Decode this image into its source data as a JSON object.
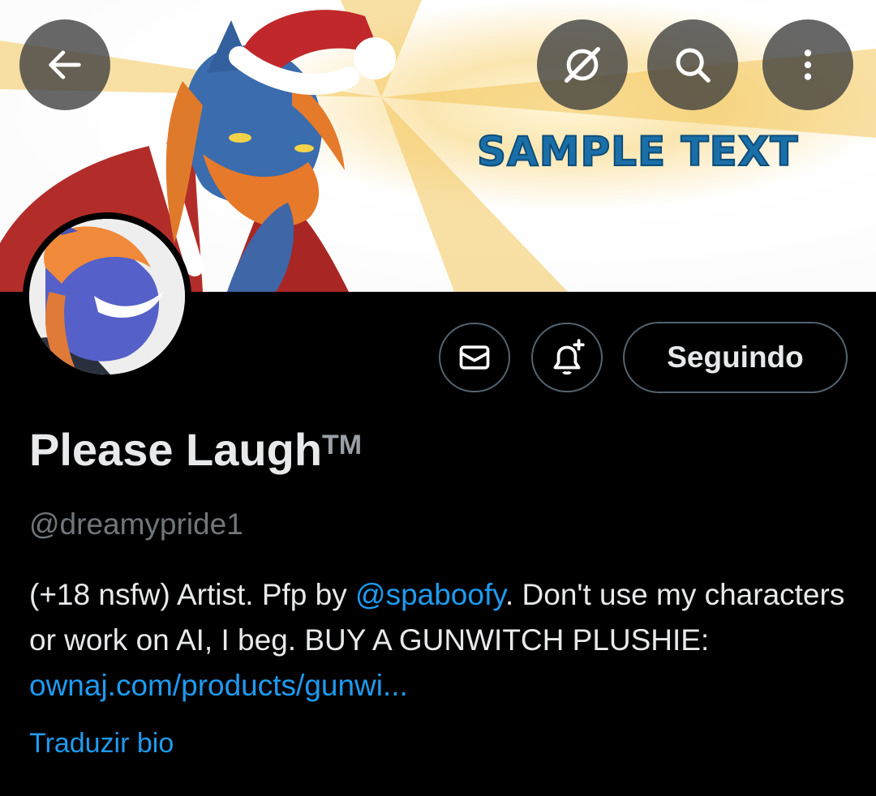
{
  "banner": {
    "text": "SAMPLE TEXT"
  },
  "header": {
    "back_icon": "arrow-left-icon",
    "no_sync_icon": "satellite-off-icon",
    "search_icon": "search-icon",
    "more_icon": "more-vertical-icon"
  },
  "actions": {
    "message_icon": "envelope-icon",
    "notify_icon": "bell-plus-icon",
    "follow_label": "Seguindo"
  },
  "profile": {
    "display_name": "Please Laugh",
    "trademark": "TM",
    "handle": "@dreamypride1",
    "bio": {
      "part1": "(+18 nsfw) Artist. Pfp by ",
      "mention": "@spaboofy",
      "part2": ". Don't use my characters or work on AI, I beg.  BUY A GUNWITCH PLUSHIE: ",
      "link": "ownaj.com/products/gunwi..."
    },
    "translate_label": "Traduzir bio"
  },
  "colors": {
    "background": "#000000",
    "accent": "#1d9bf0",
    "muted": "#71767b",
    "banner_text": "#1b6fa8"
  }
}
